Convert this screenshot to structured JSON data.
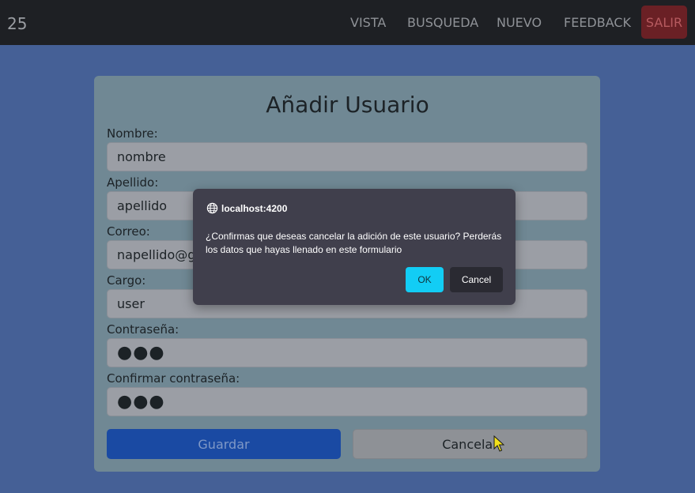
{
  "navbar": {
    "brand": "25",
    "links": [
      "VISTA",
      "BUSQUEDA",
      "NUEVO",
      "FEEDBACK"
    ],
    "exit_label": "SALIR"
  },
  "form": {
    "title": "Añadir Usuario",
    "fields": [
      {
        "label": "Nombre:",
        "value": "nombre"
      },
      {
        "label": "Apellido:",
        "value": "apellido"
      },
      {
        "label": "Correo:",
        "value": "napellido@gm"
      },
      {
        "label": "Cargo:",
        "value": "user"
      },
      {
        "label": "Contraseña:",
        "value": "●●●"
      },
      {
        "label": "Confirmar contraseña:",
        "value": "●●●"
      }
    ],
    "save_label": "Guardar",
    "cancel_label": "Cancelar"
  },
  "dialog": {
    "host": "localhost:4200",
    "message": "¿Confirmas que deseas cancelar la adición de este usuario? Perderás los datos que hayas llenado en este formulario",
    "ok_label": "OK",
    "cancel_label": "Cancel"
  },
  "icons": {
    "globe": "globe-icon",
    "cursor": "mouse-pointer-icon"
  },
  "colors": {
    "background": "#456096",
    "navbar": "#1e2024",
    "exit_button": "#6a2025",
    "card": "#708894",
    "save_button": "#1a4aa3",
    "dialog": "#403f4c",
    "dialog_ok": "#12cdf5"
  }
}
